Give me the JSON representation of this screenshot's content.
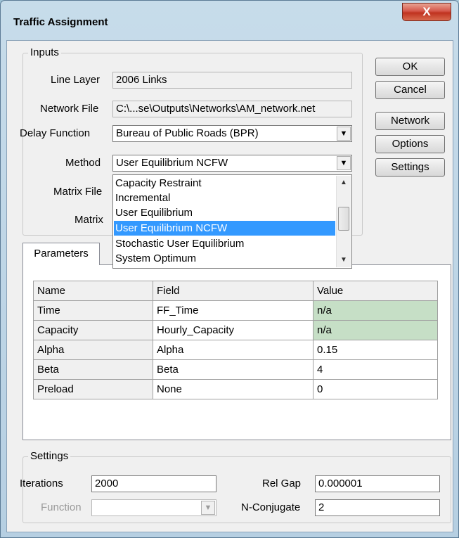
{
  "window": {
    "title": "Traffic Assignment",
    "close_label": "X"
  },
  "inputs": {
    "group_label": "Inputs",
    "line_layer_label": "Line Layer",
    "line_layer_value": "2006 Links",
    "network_file_label": "Network File",
    "network_file_value": "C:\\...se\\Outputs\\Networks\\AM_network.net",
    "delay_function_label": "Delay Function",
    "delay_function_value": "Bureau of Public Roads (BPR)",
    "method_label": "Method",
    "method_value": "User Equilibrium NCFW",
    "matrix_file_label": "Matrix File",
    "matrix_label": "Matrix",
    "method_options": [
      "Capacity Restraint",
      "Incremental",
      "User Equilibrium",
      "User Equilibrium NCFW",
      "Stochastic User Equilibrium",
      "System Optimum"
    ],
    "selected_option_index": 3
  },
  "buttons": {
    "ok": "OK",
    "cancel": "Cancel",
    "network": "Network",
    "options": "Options",
    "settings": "Settings"
  },
  "parameters": {
    "tab_label": "Parameters",
    "columns": [
      "Name",
      "Field",
      "Value"
    ],
    "rows": [
      {
        "name": "Time",
        "field": "FF_Time",
        "value": "n/a"
      },
      {
        "name": "Capacity",
        "field": "Hourly_Capacity",
        "value": "n/a"
      },
      {
        "name": "Alpha",
        "field": "Alpha",
        "value": "0.15"
      },
      {
        "name": "Beta",
        "field": "Beta",
        "value": "4"
      },
      {
        "name": "Preload",
        "field": "None",
        "value": "0"
      }
    ]
  },
  "settings": {
    "group_label": "Settings",
    "iterations_label": "Iterations",
    "iterations_value": "2000",
    "function_label": "Function",
    "function_value": "",
    "rel_gap_label": "Rel Gap",
    "rel_gap_value": "0.000001",
    "n_conjugate_label": "N-Conjugate",
    "n_conjugate_value": "2"
  },
  "colors": {
    "na_cell": "#c6dfc6",
    "selected_item": "#3399ff",
    "close_button": "#c0321f"
  }
}
